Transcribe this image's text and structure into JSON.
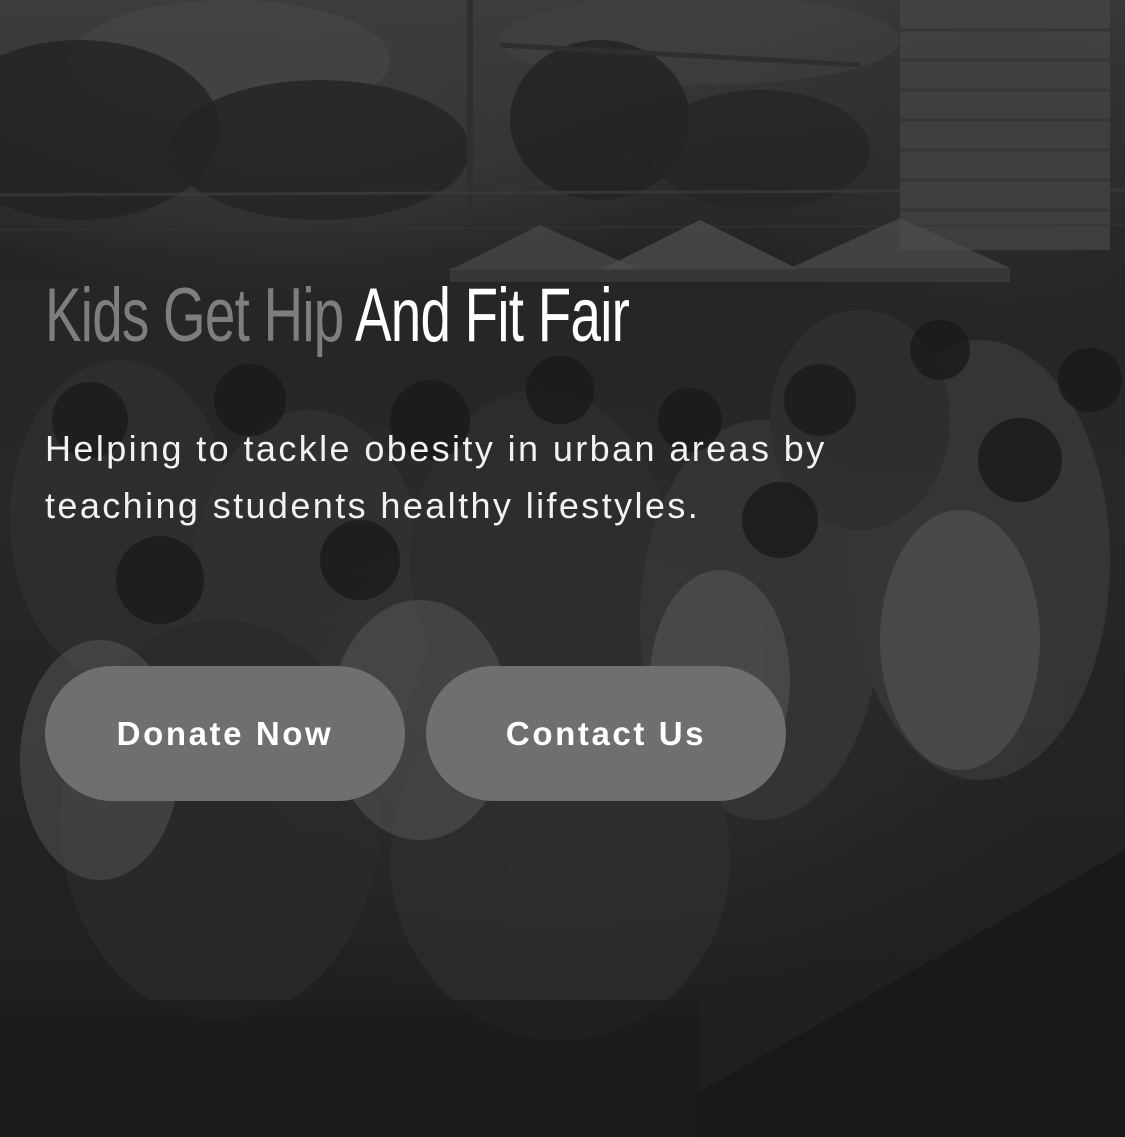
{
  "hero": {
    "title_dim": "Kids Get Hip",
    "title_bright": "And Fit Fair",
    "subtitle": "Helping to tackle obesity in urban areas by teaching students healthy lifestyles.",
    "background_image": "grayscale-crowd-of-children-outdoors-photo"
  },
  "buttons": {
    "donate_label": "Donate Now",
    "contact_label": "Contact Us"
  },
  "colors": {
    "button_bg": "#6f6f6f",
    "title_dim": "#7e7e7e",
    "title_bright": "#ffffff",
    "text": "#f2f2f2"
  }
}
